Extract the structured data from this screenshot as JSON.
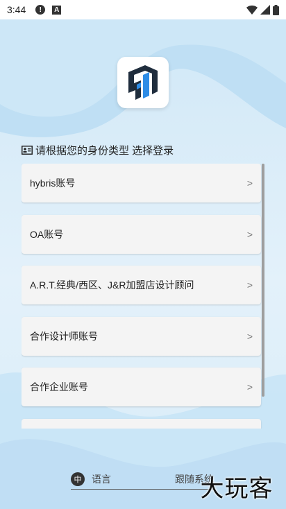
{
  "status_bar": {
    "time": "3:44",
    "alert_icon": "alert-icon",
    "app_icon_letter": "A"
  },
  "logo": {
    "icon": "app-logo-icon",
    "colors": [
      "#1f2d3d",
      "#2d8ce6"
    ]
  },
  "prompt": {
    "text": "请根据您的身份类型 选择登录"
  },
  "login_options": [
    {
      "label": "hybris账号"
    },
    {
      "label": "OA账号"
    },
    {
      "label": "A.R.T.经典/西区、J&R加盟店设计顾问"
    },
    {
      "label": "合作设计师账号"
    },
    {
      "label": "合作企业账号"
    }
  ],
  "language": {
    "icon_text": "中",
    "label": "语言",
    "value": "跟随系统"
  },
  "watermark": {
    "text": "大玩客"
  }
}
